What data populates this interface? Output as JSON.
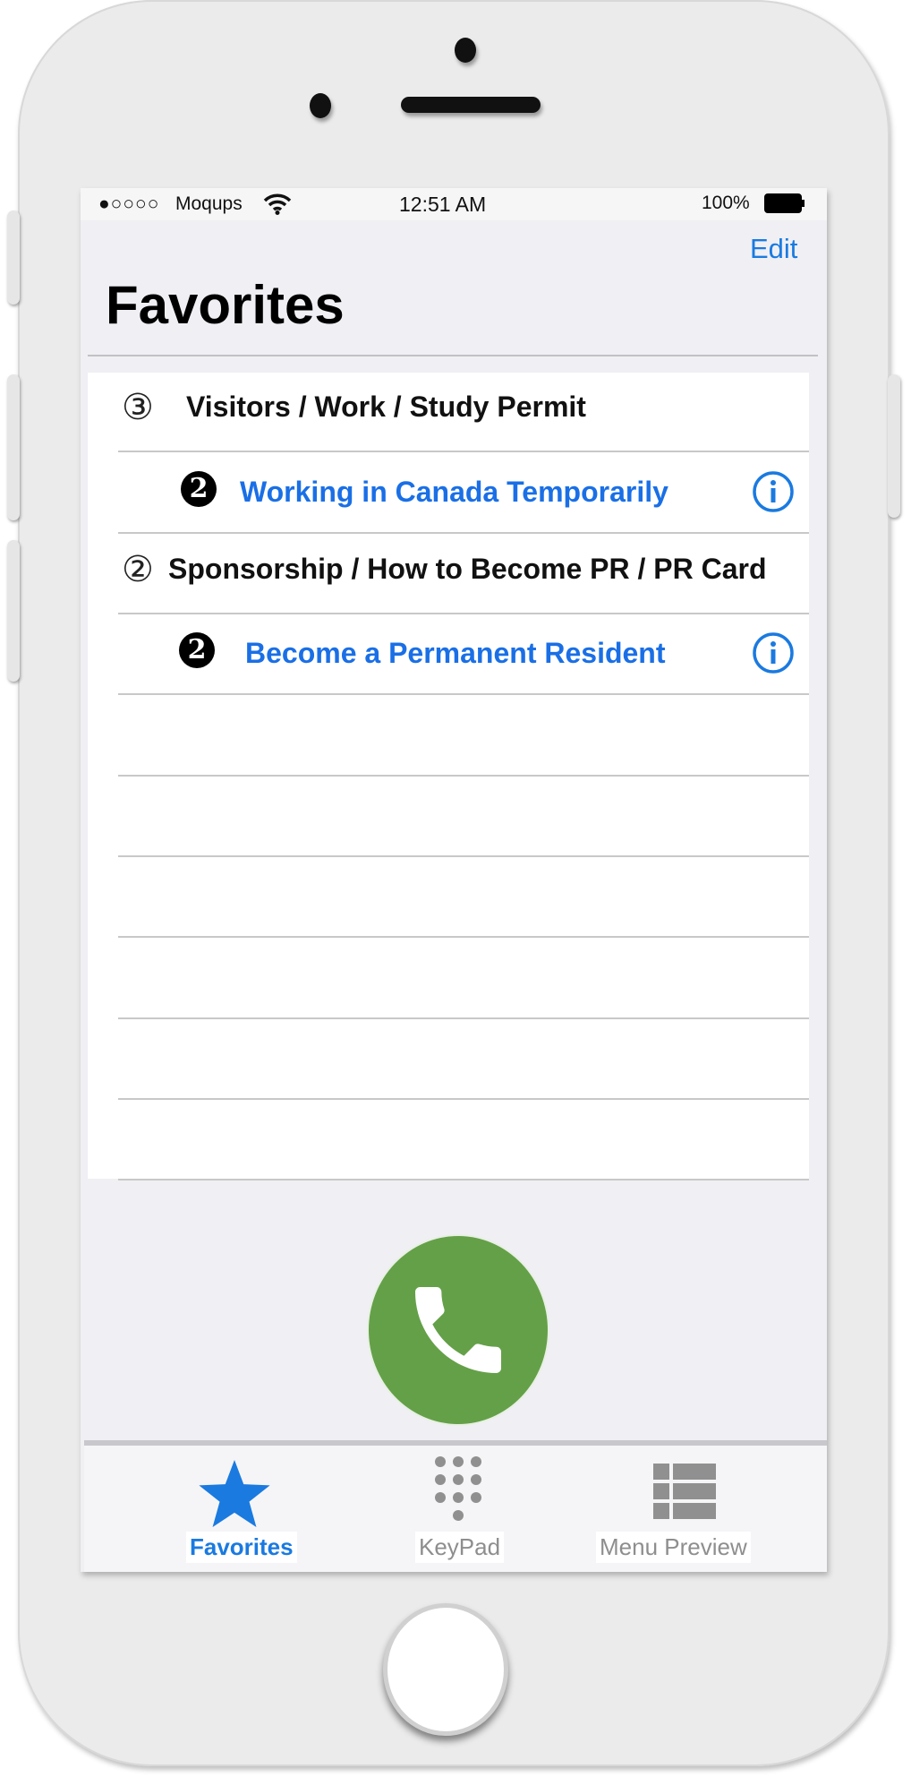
{
  "status_bar": {
    "signal": "●○○○○",
    "carrier": "Moqups",
    "time": "12:51 AM",
    "battery": "100%"
  },
  "nav": {
    "edit_label": "Edit",
    "title": "Favorites"
  },
  "favorites": [
    {
      "type": "section",
      "marker": "③",
      "label": "Visitors / Work / Study Permit"
    },
    {
      "type": "item",
      "marker": "2",
      "label": "Working in Canada Temporarily"
    },
    {
      "type": "section",
      "marker": "②",
      "label": "Sponsorship / How to Become PR / PR Card"
    },
    {
      "type": "item",
      "marker": "2",
      "label": "Become a Permanent Resident"
    }
  ],
  "call_button": {
    "icon": "phone-icon",
    "color": "#64a048"
  },
  "tabs": [
    {
      "label": "Favorites",
      "icon": "star-icon",
      "active": true
    },
    {
      "label": "KeyPad",
      "icon": "keypad-icon",
      "active": false
    },
    {
      "label": "Menu Preview",
      "icon": "list-grid-icon",
      "active": false
    }
  ],
  "colors": {
    "accent": "#1a7ae0",
    "inactive": "#8e8e8e",
    "background": "#efeff4"
  }
}
